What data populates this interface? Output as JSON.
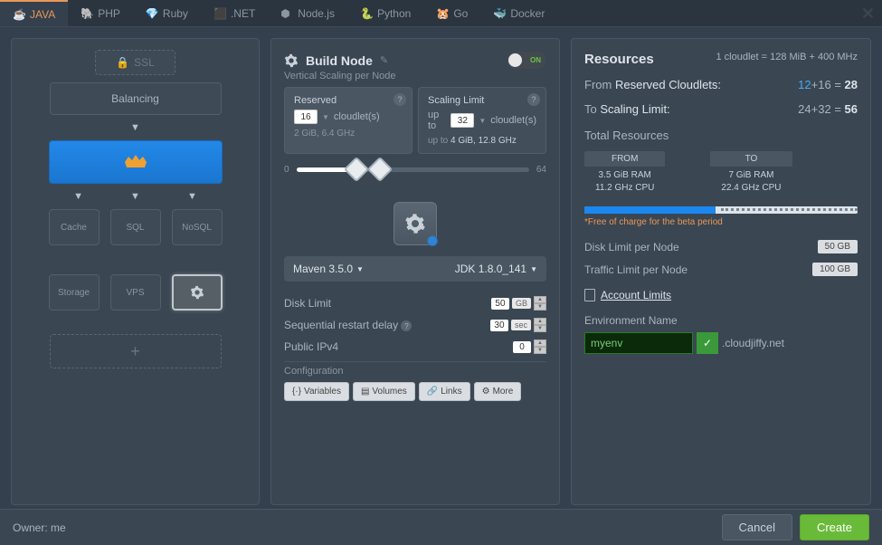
{
  "tabs": {
    "java": "JAVA",
    "php": "PHP",
    "ruby": "Ruby",
    "dotnet": ".NET",
    "nodejs": "Node.js",
    "python": "Python",
    "go": "Go",
    "docker": "Docker"
  },
  "left": {
    "ssl": "SSL",
    "balancing": "Balancing",
    "cache": "Cache",
    "sql": "SQL",
    "nosql": "NoSQL",
    "storage": "Storage",
    "vps": "VPS"
  },
  "build": {
    "title": "Build Node",
    "toggle": "ON",
    "subtitle": "Vertical Scaling per Node",
    "reserved_label": "Reserved",
    "reserved_value": "16",
    "cloudlets": "cloudlet(s)",
    "reserved_spec": "2 GiB, 6.4 GHz",
    "limit_label": "Scaling Limit",
    "limit_prefix": "up to",
    "limit_value": "32",
    "limit_spec_prefix": "up to",
    "limit_spec": "4 GiB, 12.8 GHz",
    "slider_min": "0",
    "slider_max": "64",
    "maven": "Maven 3.5.0",
    "jdk": "JDK 1.8.0_141",
    "disk_label": "Disk Limit",
    "disk_value": "50",
    "disk_unit": "GB",
    "restart_label": "Sequential restart delay",
    "restart_value": "30",
    "restart_unit": "sec",
    "ipv4_label": "Public IPv4",
    "ipv4_value": "0",
    "config_label": "Configuration",
    "btn_vars": "Variables",
    "btn_vols": "Volumes",
    "btn_links": "Links",
    "btn_more": "More"
  },
  "resources": {
    "title": "Resources",
    "note": "1 cloudlet = 128 MiB + 400 MHz",
    "from_label": "From",
    "from_text": "Reserved Cloudlets:",
    "from_a": "12",
    "plus": "+",
    "from_b": "16",
    "eq": "=",
    "from_total": "28",
    "to_label": "To",
    "to_text": "Scaling Limit:",
    "to_a": "24",
    "to_b": "32",
    "to_total": "56",
    "total_label": "Total Resources",
    "from_box_title": "FROM",
    "from_ram": "3.5 GiB RAM",
    "from_cpu": "11.2 GHz CPU",
    "to_box_title": "TO",
    "to_ram": "7 GiB RAM",
    "to_cpu": "22.4 GHz CPU",
    "beta": "*Free of charge for the beta period",
    "disk_limit_label": "Disk Limit per Node",
    "disk_limit_value": "50 GB",
    "traffic_limit_label": "Traffic Limit per Node",
    "traffic_limit_value": "100 GB",
    "account_limits": "Account Limits",
    "env_label": "Environment Name",
    "env_value": "myenv",
    "env_domain": ".cloudjiffy.net"
  },
  "footer": {
    "owner": "Owner: me",
    "cancel": "Cancel",
    "create": "Create"
  }
}
